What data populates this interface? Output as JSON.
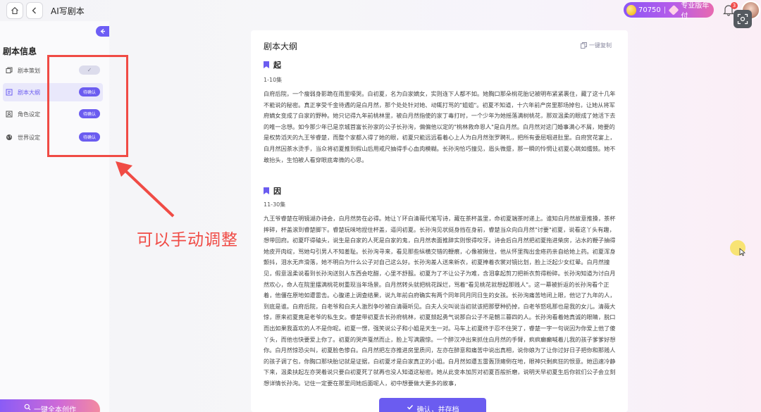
{
  "app": {
    "title": "AI写剧本"
  },
  "header": {
    "coins": "70750",
    "separator": "|",
    "vip_label": "专业版年付",
    "notification_count": "3"
  },
  "sidebar": {
    "title": "剧本信息",
    "items": [
      {
        "label": "剧本策划",
        "icon": "lightbulb-icon",
        "status": "✓"
      },
      {
        "label": "剧本大纲",
        "icon": "outline-icon",
        "status": "待确认"
      },
      {
        "label": "角色设定",
        "icon": "person-icon",
        "status": "待确认"
      },
      {
        "label": "世界设定",
        "icon": "globe-icon",
        "status": "待确认"
      }
    ],
    "create_all_label": "一键全本创作"
  },
  "annotation": {
    "text": "可以手动调整",
    "color": "#f04b45"
  },
  "main": {
    "title": "剧本大纲",
    "copy_label": "一键复制",
    "sections": [
      {
        "heading": "起",
        "episodes": "1-10集",
        "text": "白府后院，一个瘦弱身影跪在雨里嚎哭。白初夏，名为白家嫡女，实则连下人都不如。她胸口那朵桃花胎记被明布紧紧裹住，藏了这十几年不能说的秘密。真正享受千金待遇的是白月然，那个处处针对她、动辄打骂的\"姐姐\"。初夏不知道，十六年前产房里那场掉包，让她从将军府嫡女变成了白家的野种。她只记得九年前桃林里，被白月然指使的家丁毒打时，一个少年为她摇落满树桃花，那双温柔的眼成了她活下去的唯一念想。如今那少年已是京城首富长孙家的公子长孙洵，偏偏他以定的\"桃林救命恩人\"是白月然。白月然对这门婚事满心不屑，她要的是权势滔天的九王爷睿楚，而整个家都入得了她的眼，初夏只能远远看着心上人为白月然张罗聘礼，把所有委屈咽进肚里。白府赏花宴上，白月然因茶水烫手，当众将初夏推到假山后用戒尺抽得手心血肉模糊。长孙洵恰巧撞见，眉头微蹙，那一瞬的怜惘让初夏心跳如擂鼓。她不敢抬头，生怕被人看穿眼底卑微的心思。"
      },
      {
        "heading": "因",
        "episodes": "11-30集",
        "text": "九王爷睿楚在明镜湖办诗会，白月然势在必得。她让丫环白清薇代笔写诗，藏在茶杯盖里，命初夏端茶时递上。谁知白月然故意推搡，茶杯摔碎，杯盖滚到睿楚脚下。睿楚玩味地捏住杯盖，逼问初夏。长孙洵见状挺身挡在身前，睿楚当众向白月然\"讨要\"初夏，说看这丫头有趣，想带回府。初夏吓得磕头，说生是白家的人死是白家的鬼，白月然表面推辞实则恨得咬牙。诗会后白月然把初夏拖进柴房，沾水的鞭子抽得她皮开肉绽，骂她勾引男人不知羞耻。长孙洵寻来，看见那些纵横交错的鞭痕，心像被揪住，他从怀里掏出金疮药亲自给她上药。初夏浑身颤抖，泪水无声滑落，她不明白为什么公子对自己这么好。长孙洵差人送来新衣，初夏捧着衣裳对镜比划，脸上泛起少女红晕。白月然撞见，假意温柔说看到长孙洵送别人东西会吃醋，心里不舒服。初夏为了不让公子为难，含泪拿起剪刀把新衣剪得粉碎。长孙洵知道为讨白月然欢心，命人在院里摆满桃花树重现当年场景。白月然转头就把桃花踩烂，骂着\"看见桃花就想起那贱人\"。这一幕被折返的长孙洵看个正着，他僵在原地如遭雷击。心腹递上调查结果，说九年前白府确实有两个同年同月同日生的女孩。长孙洵痛苦地闭上眼，他记了九年的人，到底是谁。白府后院，白老爷和白夫人激烈争吵被白清薇听见。白夫人尖叫说当初就该把那孽种扔掉，白老爷怒吼那也是我的女儿。清薇大惊，原来初夏竟是老爷的私生女。睿楚带初夏去长孙府桃林，初夏鼓起勇气说那白公子不是朝三暮四的人。长孙洵看着她真诚的眼睛，脱口而出如果我喜欢的人不是你呢。初夏一愣，强笑说公子和小姐是天生一对。马车上初夏终于忍不住哭了，睿楚一字一句说因为你爱上他了傻丫头，而他也快要爱上你了。初夏的哭声戛然而止，脸上写满震惊。一个醉汉冲出来抓住白月然的手臂，疯疯癫癫喊着儿我的孩子爹爹好想你。白月然惊恐尖叫，初夏脸色惨白。白月然把左亦推进房里质问，左亦在醉意和痛苦中说出真相，说你娘为了让你过好日子把你和那贱人的孩子调了包，你胸口那块胎记就是证据，白初夏才是白家真正的小姐。白月然如遭五雷轰顶瘫倒在地，眼神只剩疯狂的恨意。她迅速冷静下来，温柔扶起左亦哭着说只要白初夏死了就再也没人知道这秘密。她从此变本加厉对初夏百般折磨，说明天早初夏生后你就们公子会立刻想详情长孙洵。记住一定要在那里问她后面呢人，初中想要做大更多的故事，"
      }
    ]
  },
  "footer": {
    "confirm_label": "确认，并存档"
  }
}
